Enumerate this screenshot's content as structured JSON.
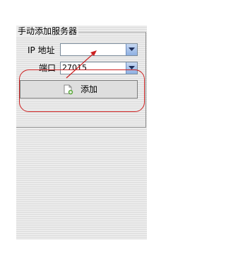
{
  "panel": {
    "title": "手动添加服务器"
  },
  "form": {
    "ip_label": "IP 地址",
    "ip_value": "",
    "port_label": "端口",
    "port_value": "27015"
  },
  "actions": {
    "add_label": "添加"
  },
  "colors": {
    "annotation": "#cc2020",
    "dropdown_accent": "#8eb0e3"
  }
}
